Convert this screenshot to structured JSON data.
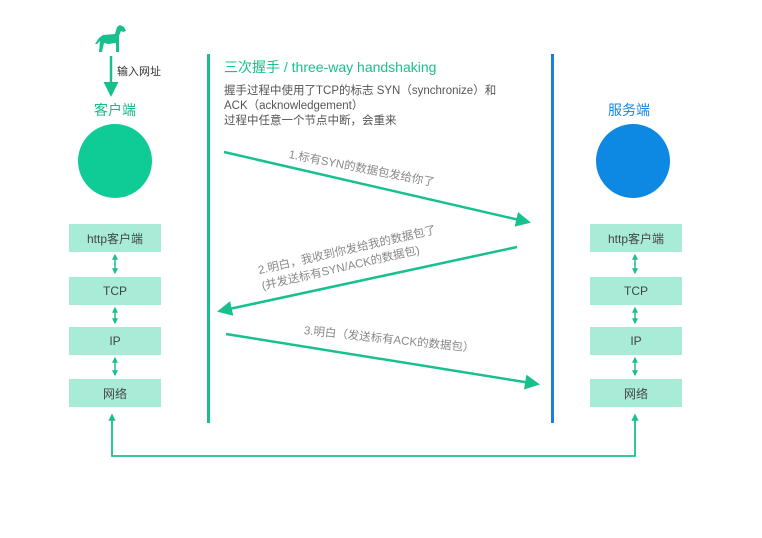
{
  "title": "三次握手 / three-way handshaking",
  "description": [
    "握手过程中使用了TCP的标志 SYN（synchronize）和",
    "ACK（acknowledgement）",
    "过程中任意一个节点中断，会重来"
  ],
  "input_label": "输入网址",
  "client": {
    "label": "客户端",
    "color": "#0fcc97"
  },
  "server": {
    "label": "服务端",
    "color": "#0d88e3"
  },
  "client_layers": [
    "http客户端",
    "TCP",
    "IP",
    "网络"
  ],
  "server_layers": [
    "http客户端",
    "TCP",
    "IP",
    "网络"
  ],
  "messages": [
    {
      "lines": [
        "1.标有SYN的数据包发给你了"
      ]
    },
    {
      "lines": [
        "2.明白，我收到你发给我的数据包了",
        "(并发送标有SYN/ACK的数据包)"
      ]
    },
    {
      "lines": [
        "3.明白（发送标有ACK的数据包）"
      ]
    }
  ],
  "colors": {
    "accent_green": "#17c08e",
    "server_blue": "#1a86e0",
    "layer_fill": "#a8ecd8"
  }
}
